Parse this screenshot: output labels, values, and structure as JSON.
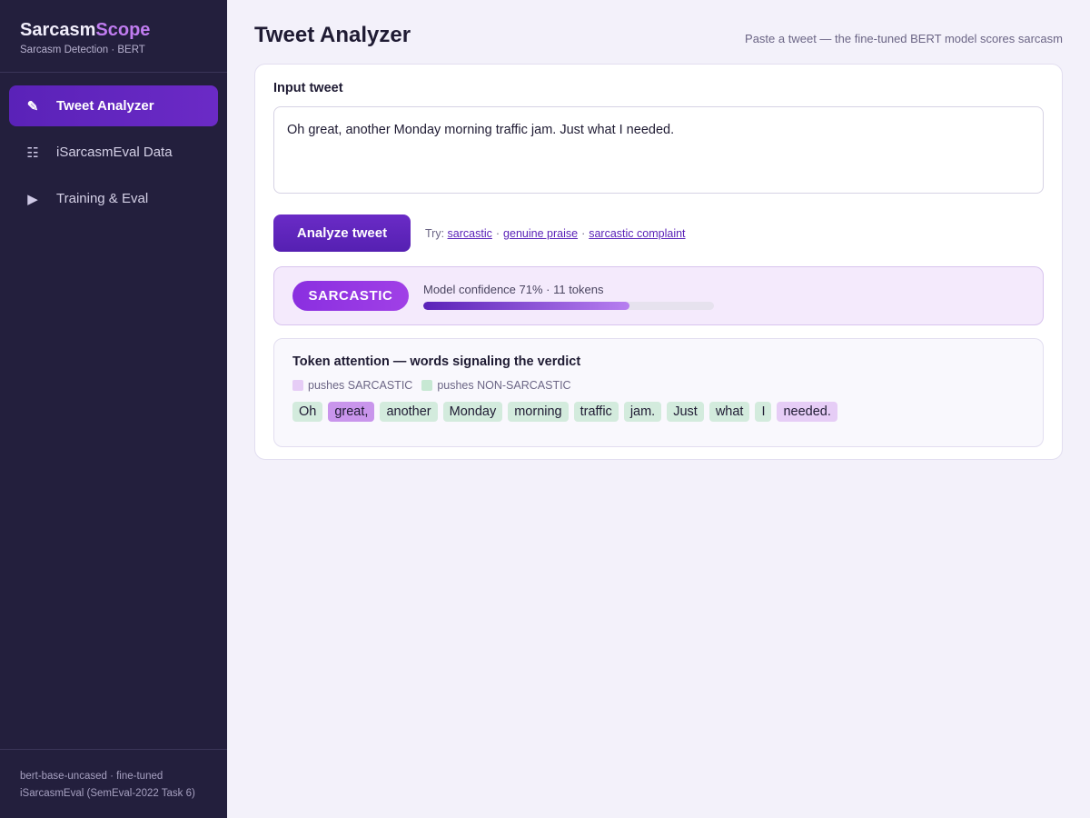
{
  "brand": {
    "title_main": "Sarcasm",
    "title_accent": "Scope",
    "subtitle": "Sarcasm Detection · BERT"
  },
  "sidebar": {
    "items": [
      {
        "label": "Tweet Analyzer",
        "icon": "pencil-icon",
        "glyph": "✎",
        "active": true
      },
      {
        "label": "iSarcasmEval Data",
        "icon": "list-icon",
        "glyph": "☷",
        "active": false
      },
      {
        "label": "Training & Eval",
        "icon": "play-icon",
        "glyph": "▶",
        "active": false
      }
    ],
    "footer_line1": "bert-base-uncased · fine-tuned",
    "footer_line2": "iSarcasmEval (SemEval-2022 Task 6)"
  },
  "header": {
    "title": "Tweet Analyzer",
    "hint": "Paste a tweet — the fine-tuned BERT model scores sarcasm"
  },
  "input": {
    "label": "Input tweet",
    "value": "Oh great, another Monday morning traffic jam. Just what I needed."
  },
  "actions": {
    "analyze_label": "Analyze tweet",
    "try_label": "Try:",
    "examples": [
      "sarcastic",
      "genuine praise",
      "sarcastic complaint"
    ],
    "separator": "·"
  },
  "verdict": {
    "label": "SARCASTIC",
    "confidence_text": "Model confidence 71% · 11 tokens",
    "confidence": 0.71
  },
  "attention": {
    "title": "Token attention — words signaling the verdict",
    "legend_sarcastic": "pushes SARCASTIC",
    "legend_non_sarcastic": "pushes NON-SARCASTIC",
    "colors": {
      "sarcastic_strong": "#c995ec",
      "sarcastic_light": "#e6cdf6",
      "non_sarcastic": "#d3ebdd"
    },
    "tokens": [
      {
        "text": "Oh",
        "push": "non"
      },
      {
        "text": "great,",
        "push": "sarc-strong"
      },
      {
        "text": "another",
        "push": "non"
      },
      {
        "text": "Monday",
        "push": "non"
      },
      {
        "text": "morning",
        "push": "non"
      },
      {
        "text": "traffic",
        "push": "non"
      },
      {
        "text": "jam.",
        "push": "non"
      },
      {
        "text": "Just",
        "push": "non"
      },
      {
        "text": "what",
        "push": "non"
      },
      {
        "text": "I",
        "push": "non"
      },
      {
        "text": "needed.",
        "push": "sarc-light"
      }
    ]
  }
}
